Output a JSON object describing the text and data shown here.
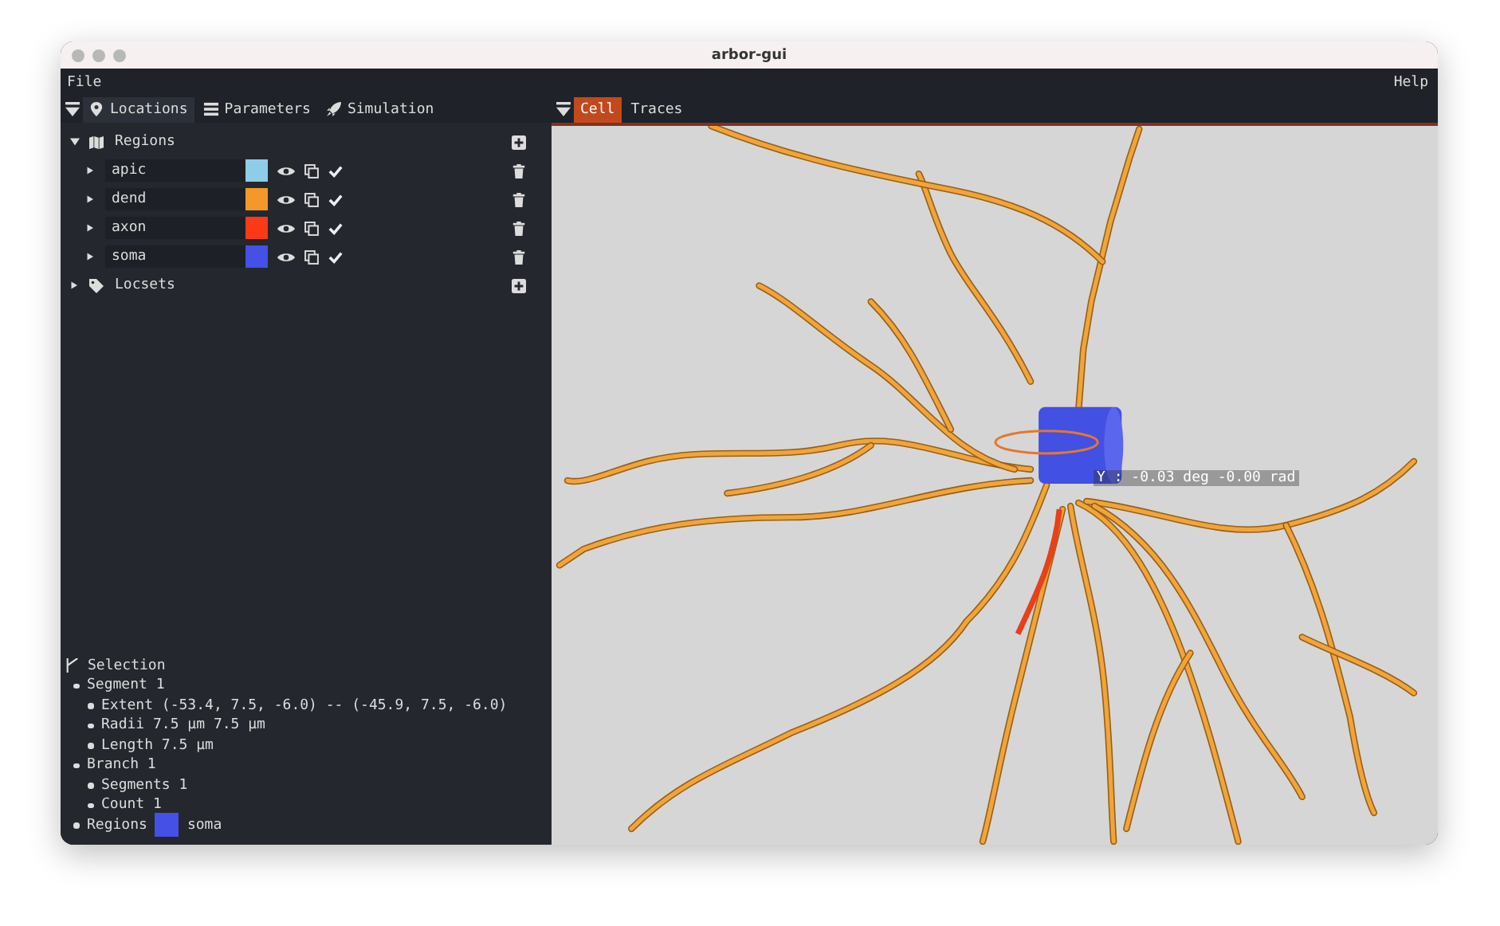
{
  "window": {
    "title": "arbor-gui"
  },
  "menu": {
    "left": "File",
    "right": "Help"
  },
  "left_tabs": [
    {
      "label": "Locations",
      "kind": "pin",
      "selected": true
    },
    {
      "label": "Parameters",
      "kind": "list",
      "selected": false
    },
    {
      "label": "Simulation",
      "kind": "rocket",
      "selected": false
    }
  ],
  "regions": {
    "label": "Regions",
    "expanded": true,
    "items": [
      {
        "name": "apic",
        "color": "#8ecde8",
        "expanded": false
      },
      {
        "name": "dend",
        "color": "#f4982a",
        "expanded": false
      },
      {
        "name": "axon",
        "color": "#fa3a14",
        "expanded": false
      },
      {
        "name": "soma",
        "color": "#4450e6",
        "expanded": false
      }
    ]
  },
  "locsets": {
    "label": "Locsets",
    "expanded": false
  },
  "selection": {
    "label": "Selection",
    "items": [
      {
        "text": "Segment 1",
        "children": [
          {
            "text": "Extent (-53.4, 7.5, -6.0) -- (-45.9, 7.5, -6.0)"
          },
          {
            "text": "Radii  7.5 µm 7.5 µm"
          },
          {
            "text": "Length 7.5 µm"
          }
        ]
      },
      {
        "text": "Branch 1",
        "children": [
          {
            "text": "Segments 1"
          },
          {
            "text": "Count 1"
          }
        ]
      },
      {
        "text": "Regions",
        "kind": "swatch",
        "color": "#4450e6",
        "value": "soma"
      }
    ]
  },
  "right_tabs": [
    {
      "label": "Cell",
      "selected": true
    },
    {
      "label": "Traces",
      "selected": false
    }
  ],
  "viewport": {
    "gizmo_label": "Y : -0.03 deg -0.00 rad"
  }
}
